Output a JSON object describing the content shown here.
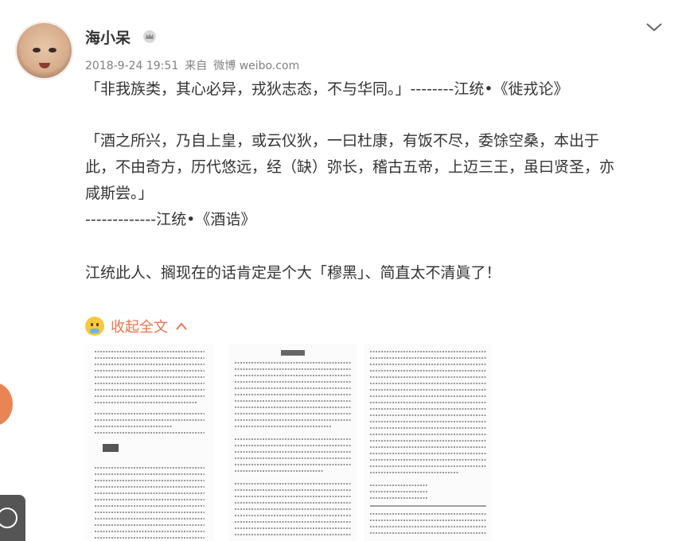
{
  "post": {
    "author": "海小呆",
    "time": "2018-9-24 19:51",
    "source_prefix": "来自",
    "source": "微博 weibo.com",
    "lines": [
      "「非我族类，其心必异，戎狄志态，不与华同。」--------江统•《徙戎论》",
      "「酒之所兴，乃自上皇，或云仪狄，一曰杜康，有饭不尽，委馀空桑，本出于",
      "此，不由奇方，历代悠远，经（缺）弥长，稽古五帝，上迈三王，虽曰贤圣，亦",
      "咸斯尝。」",
      "-------------江统•《酒诰》",
      "江统此人、搁现在的话肯定是个大「穆黑」、简直太不清眞了！"
    ],
    "collapse_label": "收起全文"
  },
  "icons": {
    "crown": "crown-icon",
    "menu": "chevron-down-icon",
    "emoji": "emoji-icon",
    "collapse": "chevron-up-icon"
  },
  "colors": {
    "accent": "#eb7350",
    "meta_text": "#808080",
    "body_text": "#333333"
  }
}
